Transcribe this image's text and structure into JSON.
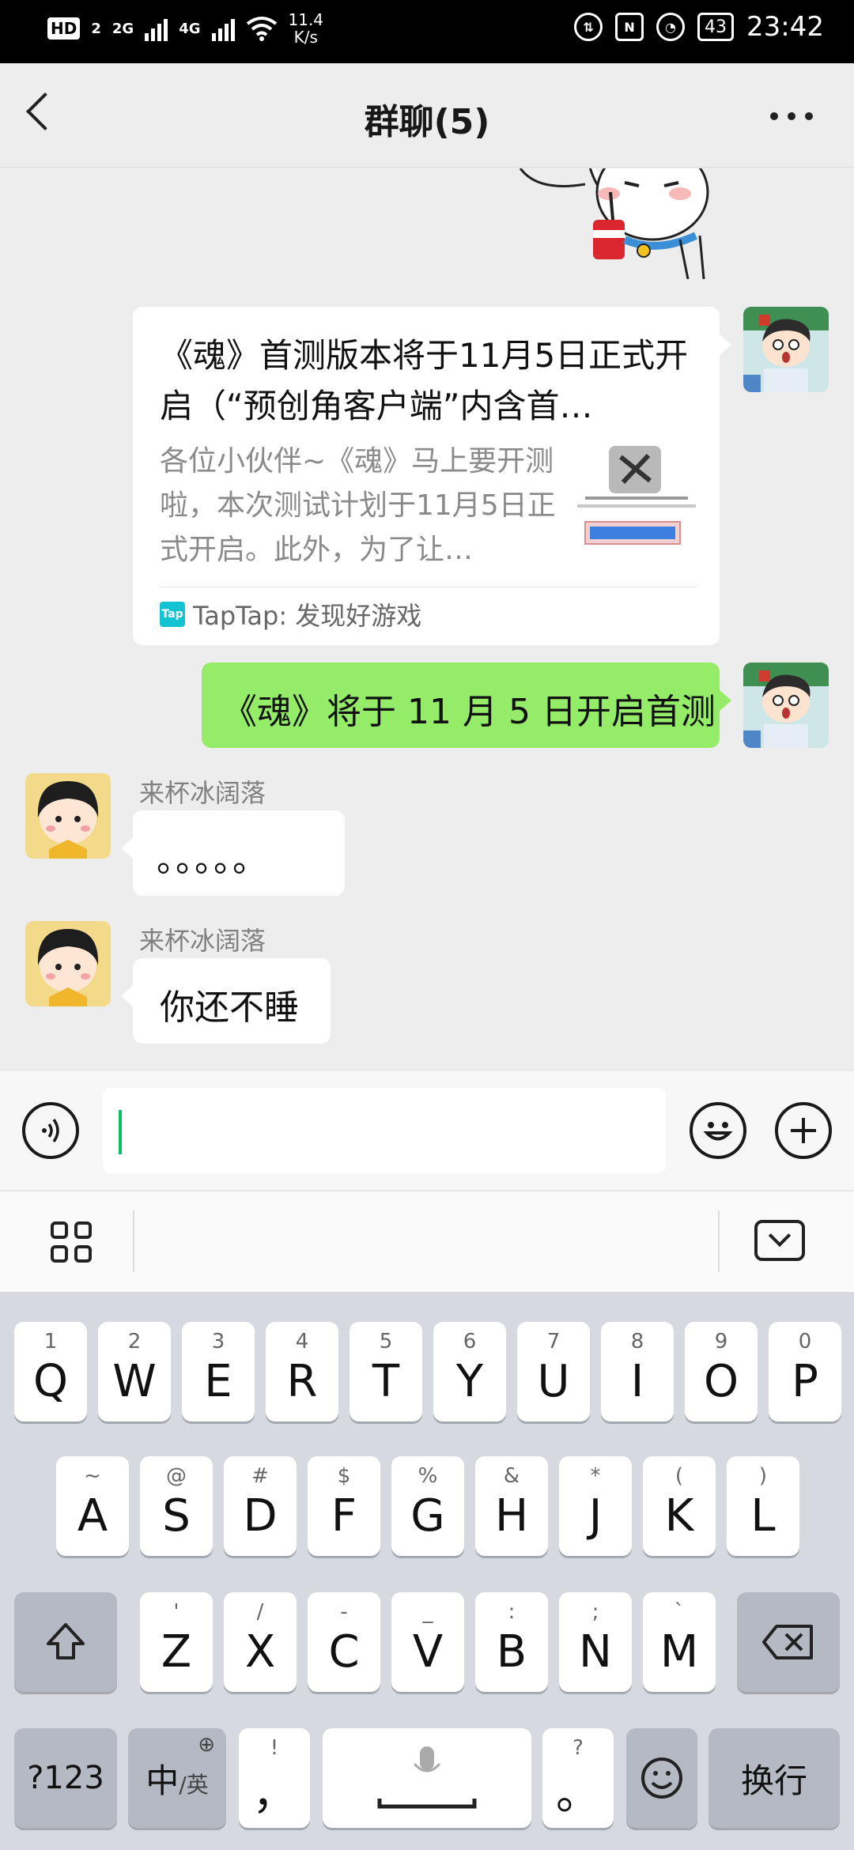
{
  "status_bar": {
    "hd": "HD",
    "sim": "2",
    "net1": "2G",
    "net2": "4G",
    "speed_value": "11.4",
    "speed_unit": "K/s",
    "battery": "43",
    "time": "23:42",
    "icons": [
      "hd-icon",
      "signal-icon",
      "wifi-icon",
      "volte-icon",
      "nfc-icon",
      "alarm-icon",
      "battery-icon"
    ]
  },
  "header": {
    "title": "群聊(5)",
    "back_icon": "chevron-left-icon",
    "more_icon": "more-dots-icon"
  },
  "messages": [
    {
      "type": "link-card",
      "side": "right",
      "title": "《魂》首测版本将于11月5日正式开启（“预创角客户端”内含首…",
      "description": "各位小伙伴~《魂》马上要开测啦，本次测试计划于11月5日正式开启。此外，为了让…",
      "source": "TapTap: 发现好游戏",
      "source_icon": "Tap"
    },
    {
      "type": "text",
      "side": "right",
      "text": "《魂》将于 11 月 5 日开启首测"
    },
    {
      "type": "text",
      "side": "left",
      "sender": "来杯冰阔落",
      "text": "。。。。。"
    },
    {
      "type": "text",
      "side": "left",
      "sender": "来杯冰阔落",
      "text": "你还不睡"
    }
  ],
  "input_bar": {
    "voice_icon": "voice-icon",
    "emoji_icon": "emoji-icon",
    "plus_icon": "plus-icon",
    "value": ""
  },
  "keyboard": {
    "row1": [
      {
        "main": "Q",
        "hint": "1"
      },
      {
        "main": "W",
        "hint": "2"
      },
      {
        "main": "E",
        "hint": "3"
      },
      {
        "main": "R",
        "hint": "4"
      },
      {
        "main": "T",
        "hint": "5"
      },
      {
        "main": "Y",
        "hint": "6"
      },
      {
        "main": "U",
        "hint": "7"
      },
      {
        "main": "I",
        "hint": "8"
      },
      {
        "main": "O",
        "hint": "9"
      },
      {
        "main": "P",
        "hint": "0"
      }
    ],
    "row2": [
      {
        "main": "A",
        "hint": "~"
      },
      {
        "main": "S",
        "hint": "@"
      },
      {
        "main": "D",
        "hint": "#"
      },
      {
        "main": "F",
        "hint": "$"
      },
      {
        "main": "G",
        "hint": "%"
      },
      {
        "main": "H",
        "hint": "&"
      },
      {
        "main": "J",
        "hint": "*"
      },
      {
        "main": "K",
        "hint": "("
      },
      {
        "main": "L",
        "hint": ")"
      }
    ],
    "row3": [
      {
        "main": "Z",
        "hint": "'"
      },
      {
        "main": "X",
        "hint": "/"
      },
      {
        "main": "C",
        "hint": "-"
      },
      {
        "main": "V",
        "hint": "_"
      },
      {
        "main": "B",
        "hint": ":"
      },
      {
        "main": "N",
        "hint": ";"
      },
      {
        "main": "M",
        "hint": "`"
      }
    ],
    "num_label": "?123",
    "lang_main": "中",
    "lang_sub": "/英",
    "comma_main": "，",
    "comma_hint": "!",
    "period_main": "。",
    "period_hint": "?",
    "enter_label": "换行"
  }
}
